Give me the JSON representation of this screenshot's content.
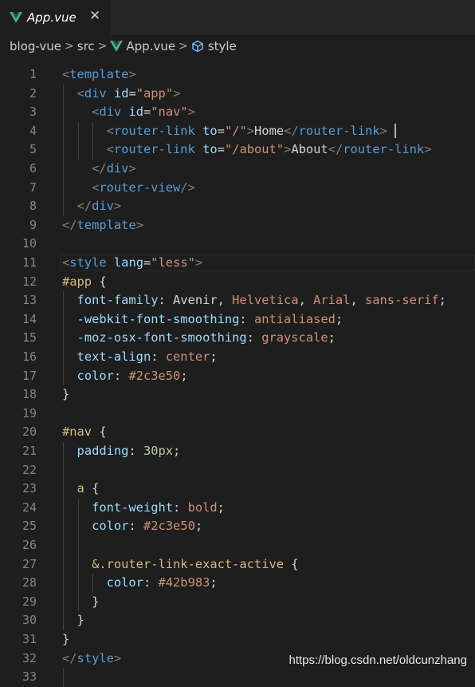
{
  "tab": {
    "title": "App.vue",
    "close": "✕",
    "icon": "vue-icon"
  },
  "breadcrumb": {
    "items": [
      "blog-vue",
      "src",
      "App.vue",
      "style"
    ]
  },
  "colors": {
    "tag": "#569cd6",
    "attr": "#9cdcfe",
    "string": "#ce9178",
    "text": "#d4d4d4",
    "punct": "#808080",
    "selector": "#d7ba7d",
    "number": "#b5cea8",
    "vue_green": "#41b883"
  },
  "editor": {
    "lines": [
      {
        "n": "1",
        "t": [
          [
            "<",
            "p"
          ],
          [
            "template",
            "tag"
          ],
          [
            ">",
            "p"
          ]
        ]
      },
      {
        "n": "2",
        "t": [
          [
            "  ",
            "x"
          ],
          [
            "<",
            "p"
          ],
          [
            "div",
            "tag"
          ],
          [
            " ",
            "x"
          ],
          [
            "id",
            "attr"
          ],
          [
            "=",
            "x"
          ],
          [
            "\"app\"",
            "str"
          ],
          [
            ">",
            "p"
          ]
        ]
      },
      {
        "n": "3",
        "t": [
          [
            "    ",
            "x"
          ],
          [
            "<",
            "p"
          ],
          [
            "div",
            "tag"
          ],
          [
            " ",
            "x"
          ],
          [
            "id",
            "attr"
          ],
          [
            "=",
            "x"
          ],
          [
            "\"nav\"",
            "str"
          ],
          [
            ">",
            "p"
          ]
        ]
      },
      {
        "n": "4",
        "t": [
          [
            "      ",
            "x"
          ],
          [
            "<",
            "p"
          ],
          [
            "router-link",
            "tag"
          ],
          [
            " ",
            "x"
          ],
          [
            "to",
            "attr"
          ],
          [
            "=",
            "x"
          ],
          [
            "\"/\"",
            "str"
          ],
          [
            ">",
            "p"
          ],
          [
            "Home",
            "x"
          ],
          [
            "</",
            "p"
          ],
          [
            "router-link",
            "tag"
          ],
          [
            ">",
            "p"
          ],
          [
            " ",
            "x"
          ],
          [
            "|",
            "cursor"
          ]
        ]
      },
      {
        "n": "5",
        "t": [
          [
            "      ",
            "x"
          ],
          [
            "<",
            "p"
          ],
          [
            "router-link",
            "tag"
          ],
          [
            " ",
            "x"
          ],
          [
            "to",
            "attr"
          ],
          [
            "=",
            "x"
          ],
          [
            "\"/about\"",
            "str"
          ],
          [
            ">",
            "p"
          ],
          [
            "About",
            "x"
          ],
          [
            "</",
            "p"
          ],
          [
            "router-link",
            "tag"
          ],
          [
            ">",
            "p"
          ]
        ]
      },
      {
        "n": "6",
        "t": [
          [
            "    ",
            "x"
          ],
          [
            "</",
            "p"
          ],
          [
            "div",
            "tag"
          ],
          [
            ">",
            "p"
          ]
        ]
      },
      {
        "n": "7",
        "t": [
          [
            "    ",
            "x"
          ],
          [
            "<",
            "p"
          ],
          [
            "router-view",
            "tag"
          ],
          [
            "/>",
            "p"
          ]
        ]
      },
      {
        "n": "8",
        "t": [
          [
            "  ",
            "x"
          ],
          [
            "</",
            "p"
          ],
          [
            "div",
            "tag"
          ],
          [
            ">",
            "p"
          ]
        ]
      },
      {
        "n": "9",
        "t": [
          [
            "</",
            "p"
          ],
          [
            "template",
            "tag"
          ],
          [
            ">",
            "p"
          ]
        ]
      },
      {
        "n": "10",
        "t": []
      },
      {
        "n": "11",
        "t": [
          [
            "<",
            "p"
          ],
          [
            "style",
            "tag"
          ],
          [
            " ",
            "x"
          ],
          [
            "lang",
            "attr"
          ],
          [
            "=",
            "x"
          ],
          [
            "\"less\"",
            "str"
          ],
          [
            ">",
            "p"
          ]
        ]
      },
      {
        "n": "12",
        "t": [
          [
            "#app",
            "sel"
          ],
          [
            " {",
            "x"
          ]
        ]
      },
      {
        "n": "13",
        "t": [
          [
            "  ",
            "x"
          ],
          [
            "font-family",
            "attr"
          ],
          [
            ": Avenir, ",
            "x"
          ],
          [
            "Helvetica",
            "str"
          ],
          [
            ", ",
            "x"
          ],
          [
            "Arial",
            "str"
          ],
          [
            ", ",
            "x"
          ],
          [
            "sans-serif",
            "str"
          ],
          [
            ";",
            "x"
          ]
        ]
      },
      {
        "n": "14",
        "t": [
          [
            "  ",
            "x"
          ],
          [
            "-webkit-font-smoothing",
            "attr"
          ],
          [
            ": ",
            "x"
          ],
          [
            "antialiased",
            "str"
          ],
          [
            ";",
            "x"
          ]
        ]
      },
      {
        "n": "15",
        "t": [
          [
            "  ",
            "x"
          ],
          [
            "-moz-osx-font-smoothing",
            "attr"
          ],
          [
            ": ",
            "x"
          ],
          [
            "grayscale",
            "str"
          ],
          [
            ";",
            "x"
          ]
        ]
      },
      {
        "n": "16",
        "t": [
          [
            "  ",
            "x"
          ],
          [
            "text-align",
            "attr"
          ],
          [
            ": ",
            "x"
          ],
          [
            "center",
            "str"
          ],
          [
            ";",
            "x"
          ]
        ]
      },
      {
        "n": "17",
        "t": [
          [
            "  ",
            "x"
          ],
          [
            "color",
            "attr"
          ],
          [
            ": ",
            "x"
          ],
          [
            "#2c3e50",
            "str"
          ],
          [
            ";",
            "x"
          ]
        ]
      },
      {
        "n": "18",
        "t": [
          [
            "}",
            "x"
          ]
        ]
      },
      {
        "n": "19",
        "t": []
      },
      {
        "n": "20",
        "t": [
          [
            "#nav",
            "sel"
          ],
          [
            " {",
            "x"
          ]
        ]
      },
      {
        "n": "21",
        "t": [
          [
            "  ",
            "x"
          ],
          [
            "padding",
            "attr"
          ],
          [
            ": ",
            "x"
          ],
          [
            "30px",
            "num"
          ],
          [
            ";",
            "x"
          ]
        ]
      },
      {
        "n": "22",
        "t": []
      },
      {
        "n": "23",
        "t": [
          [
            "  ",
            "x"
          ],
          [
            "a",
            "sel"
          ],
          [
            " {",
            "x"
          ]
        ]
      },
      {
        "n": "24",
        "t": [
          [
            "    ",
            "x"
          ],
          [
            "font-weight",
            "attr"
          ],
          [
            ": ",
            "x"
          ],
          [
            "bold",
            "str"
          ],
          [
            ";",
            "x"
          ]
        ]
      },
      {
        "n": "25",
        "t": [
          [
            "    ",
            "x"
          ],
          [
            "color",
            "attr"
          ],
          [
            ": ",
            "x"
          ],
          [
            "#2c3e50",
            "str"
          ],
          [
            ";",
            "x"
          ]
        ]
      },
      {
        "n": "26",
        "t": []
      },
      {
        "n": "27",
        "t": [
          [
            "    ",
            "x"
          ],
          [
            "&.router-link-exact-active",
            "sel"
          ],
          [
            " {",
            "x"
          ]
        ]
      },
      {
        "n": "28",
        "t": [
          [
            "      ",
            "x"
          ],
          [
            "color",
            "attr"
          ],
          [
            ": ",
            "x"
          ],
          [
            "#42b983",
            "str"
          ],
          [
            ";",
            "x"
          ]
        ]
      },
      {
        "n": "29",
        "t": [
          [
            "    ",
            "x"
          ],
          [
            "}",
            "x"
          ]
        ]
      },
      {
        "n": "30",
        "t": [
          [
            "  ",
            "x"
          ],
          [
            "}",
            "x"
          ]
        ]
      },
      {
        "n": "31",
        "t": [
          [
            "}",
            "x"
          ]
        ]
      },
      {
        "n": "32",
        "t": [
          [
            "</",
            "p"
          ],
          [
            "style",
            "tag"
          ],
          [
            ">",
            "p"
          ]
        ]
      },
      {
        "n": "33",
        "t": []
      }
    ]
  },
  "watermark": "https://blog.csdn.net/oldcunzhang"
}
